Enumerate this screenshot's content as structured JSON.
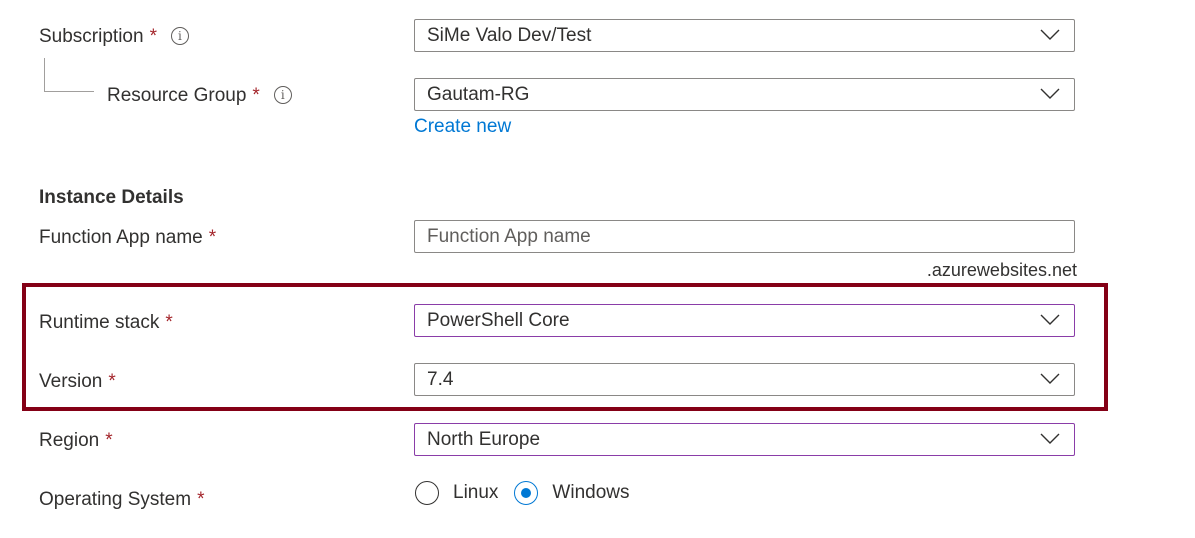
{
  "fields": {
    "subscription": {
      "label": "Subscription",
      "required": "*",
      "info_icon": "i",
      "value": "SiMe Valo Dev/Test"
    },
    "resource_group": {
      "label": "Resource Group",
      "required": "*",
      "info_icon": "i",
      "value": "Gautam-RG",
      "create_new_link": "Create new"
    },
    "section_title": "Instance Details",
    "function_app_name": {
      "label": "Function App name",
      "required": "*",
      "value": "",
      "placeholder": "Function App name",
      "suffix": ".azurewebsites.net"
    },
    "runtime_stack": {
      "label": "Runtime stack",
      "required": "*",
      "value": "PowerShell Core"
    },
    "version": {
      "label": "Version",
      "required": "*",
      "value": "7.4"
    },
    "region": {
      "label": "Region",
      "required": "*",
      "value": "North Europe"
    },
    "operating_system": {
      "label": "Operating System",
      "required": "*",
      "options": [
        {
          "label": "Linux",
          "checked": false
        },
        {
          "label": "Windows",
          "checked": true
        }
      ]
    }
  },
  "colors": {
    "highlight_box": "#840016",
    "required": "#a4262c",
    "link": "#0078d4",
    "radio_selected": "#0078d4",
    "accent_border": "#8a3da8"
  }
}
